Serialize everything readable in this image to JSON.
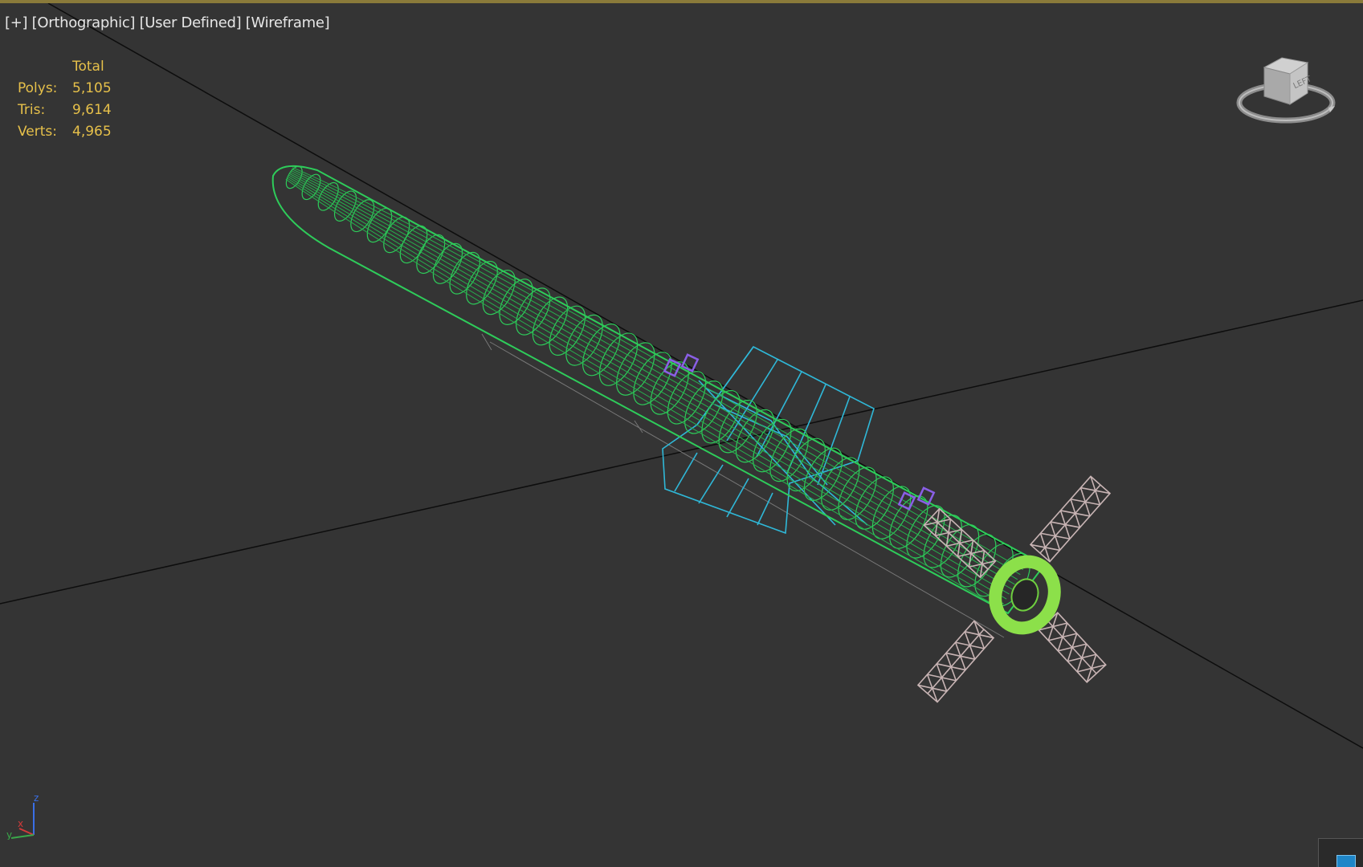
{
  "viewport": {
    "labels": {
      "plus": "[+]",
      "projection": "[Orthographic]",
      "view": "[User Defined]",
      "shading": "[Wireframe]"
    }
  },
  "stats": {
    "header": "Total",
    "polys_label": "Polys:",
    "polys": "5,105",
    "tris_label": "Tris:",
    "tris": "9,614",
    "verts_label": "Verts:",
    "verts": "4,965"
  },
  "viewcube": {
    "face_label": "LEFT"
  },
  "axis_tripod": {
    "z": "z",
    "x": "x",
    "y": "y"
  },
  "colors": {
    "background": "#343434",
    "hull_wire": "#2ecc5a",
    "fin_wire": "#2fb8d8",
    "panel_wire": "#c8b4b4",
    "marker": "#8a5fe6",
    "stats_text": "#e6c04a",
    "grid_line": "#0d0d0d"
  },
  "icons": {
    "viewcube": "viewcube-icon",
    "axis": "axis-tripod-icon",
    "corner": "viewport-config-icon"
  }
}
